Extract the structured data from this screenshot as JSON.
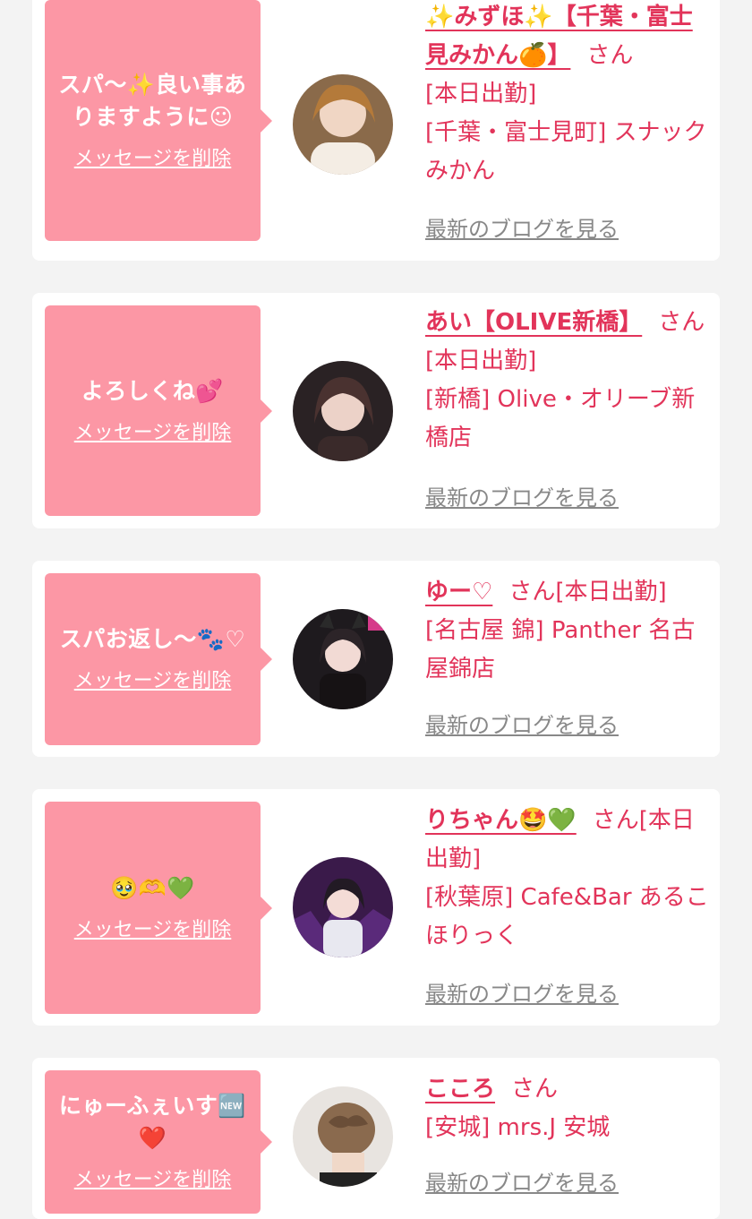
{
  "colors": {
    "page_bg": "#f3f3f3",
    "card_bg": "#ffffff",
    "bubble_bg": "#fc97a5",
    "accent_text": "#e2345a",
    "link_gray": "#888888"
  },
  "items": [
    {
      "message": "スパ〜✨良い事ありますように☺",
      "delete_label": "メッセージを削除",
      "name": "✨みずほ✨【千葉・富士見みかん🍊】",
      "honorific": "さん",
      "status": "[本日出勤]",
      "shop": "[千葉・富士見町] スナックみかん",
      "blog_label": "最新のブログを見る",
      "avatar_icon": "avatar-photo"
    },
    {
      "message": "よろしくね💕",
      "delete_label": "メッセージを削除",
      "name": "あい【OLIVE新橋】",
      "honorific": "さん",
      "status": "[本日出勤]",
      "shop": "[新橋] Olive・オリーブ新橋店",
      "blog_label": "最新のブログを見る",
      "avatar_icon": "avatar-photo"
    },
    {
      "message": "スパお返し〜🐾♡",
      "delete_label": "メッセージを削除",
      "name": "ゆー♡",
      "honorific": "さん",
      "status": "[本日出勤]",
      "shop": "[名古屋 錦] Panther 名古屋錦店",
      "blog_label": "最新のブログを見る",
      "avatar_icon": "avatar-photo"
    },
    {
      "message": "🥹🫶💚",
      "delete_label": "メッセージを削除",
      "name": "りちゃん🤩💚",
      "honorific": "さん",
      "status": "[本日出勤]",
      "shop": "[秋葉原] Cafe&Bar あるこほりっく",
      "blog_label": "最新のブログを見る",
      "avatar_icon": "avatar-photo"
    },
    {
      "message": "にゅーふぇいす🆕❤️",
      "delete_label": "メッセージを削除",
      "name": "こころ",
      "honorific": "さん",
      "status": "",
      "shop": "[安城] mrs.J 安城",
      "blog_label": "最新のブログを見る",
      "avatar_icon": "avatar-photo"
    }
  ]
}
